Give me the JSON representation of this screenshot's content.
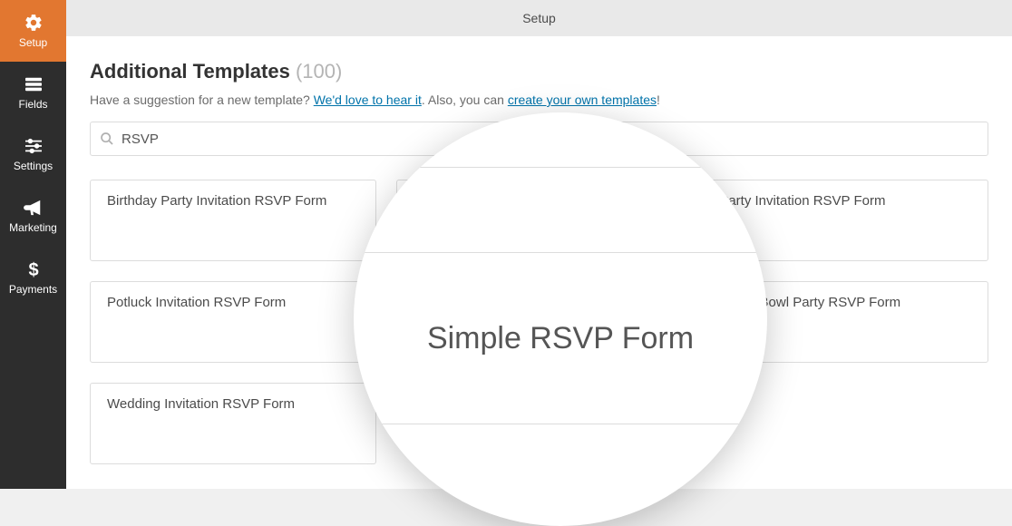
{
  "sidebar": {
    "items": [
      {
        "label": "Setup"
      },
      {
        "label": "Fields"
      },
      {
        "label": "Settings"
      },
      {
        "label": "Marketing"
      },
      {
        "label": "Payments"
      }
    ]
  },
  "topbar": {
    "title": "Setup"
  },
  "page": {
    "title_main": "Additional Templates ",
    "title_count": "(100)",
    "subtitle_pre": "Have a suggestion for a new template? ",
    "subtitle_link1": "We'd love to hear it",
    "subtitle_mid": ". Also, you can ",
    "subtitle_link2": "create your own templates",
    "subtitle_post": "!"
  },
  "search": {
    "value": "RSVP"
  },
  "templates": [
    "Birthday Party Invitation RSVP Form",
    "",
    "Party Invitation RSVP Form",
    "Potluck Invitation RSVP Form",
    "Simple RSVP Form",
    "Super Bowl Party RSVP Form",
    "Wedding Invitation RSVP Form"
  ],
  "magnifier": {
    "text": "Simple RSVP Form"
  }
}
